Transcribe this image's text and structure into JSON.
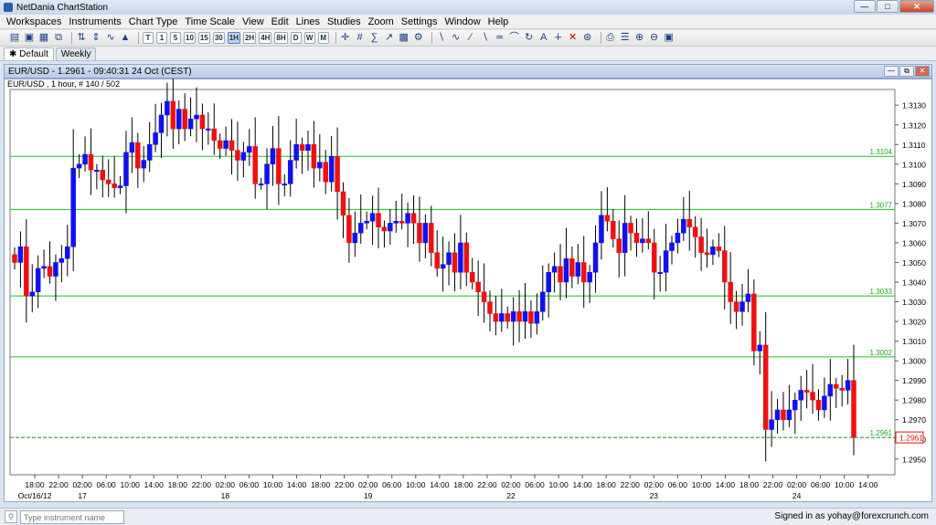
{
  "window": {
    "title": "NetDania ChartStation"
  },
  "menu": [
    "Workspaces",
    "Instruments",
    "Chart Type",
    "Time Scale",
    "View",
    "Edit",
    "Lines",
    "Studies",
    "Zoom",
    "Settings",
    "Window",
    "Help"
  ],
  "toolbar": {
    "timeframes": [
      "T",
      "1",
      "5",
      "10",
      "15",
      "30",
      "1H",
      "2H",
      "4H",
      "8H",
      "D",
      "W",
      "M"
    ],
    "selected_timeframe": "1H"
  },
  "tabs": [
    {
      "label": "Default",
      "active": true
    },
    {
      "label": "Weekly",
      "active": false
    }
  ],
  "chart_window": {
    "title": "EUR/USD - 1.2961 - 09:40:31  24 Oct (CEST)"
  },
  "chart_info": "EUR/USD , 1 hour, # 140 / 502",
  "colors": {
    "up": "#1010f0",
    "down": "#f01010",
    "hline": "#1fc01f",
    "current": "#1a8a1a",
    "price_tag": "#e01010"
  },
  "chart_data": {
    "type": "candlestick",
    "symbol": "EUR/USD",
    "ylim": [
      1.2942,
      1.3138
    ],
    "y_ticks": [
      "1.3130",
      "1.3120",
      "1.3110",
      "1.3100",
      "1.3090",
      "1.3080",
      "1.3070",
      "1.3060",
      "1.3050",
      "1.3040",
      "1.3030",
      "1.3020",
      "1.3010",
      "1.3000",
      "1.2990",
      "1.2980",
      "1.2970",
      "1.2960",
      "1.2950"
    ],
    "x_ticks": [
      "18:00",
      "22:00",
      "02:00",
      "06:00",
      "10:00",
      "14:00",
      "18:00",
      "22:00",
      "02:00",
      "06:00",
      "10:00",
      "14:00",
      "18:00",
      "22:00",
      "02:00",
      "06:00",
      "10:00",
      "14:00",
      "18:00",
      "22:00",
      "02:00",
      "06:00",
      "10:00",
      "14:00",
      "18:00",
      "22:00",
      "02:00",
      "06:00",
      "10:00",
      "14:00",
      "18:00",
      "22:00",
      "02:00",
      "06:00",
      "10:00",
      "14:00"
    ],
    "date_labels": [
      {
        "label": "Oct/16/12",
        "tick_index": 0
      },
      {
        "label": "17",
        "tick_index": 2
      },
      {
        "label": "18",
        "tick_index": 8
      },
      {
        "label": "19",
        "tick_index": 14
      },
      {
        "label": "22",
        "tick_index": 20
      },
      {
        "label": "23",
        "tick_index": 26
      },
      {
        "label": "24",
        "tick_index": 32
      }
    ],
    "horizontal_lines": [
      {
        "value": 1.3104,
        "label": "1.3104"
      },
      {
        "value": 1.3077,
        "label": "1.3077"
      },
      {
        "value": 1.3033,
        "label": "1.3033"
      },
      {
        "value": 1.3002,
        "label": "1.3002"
      },
      {
        "value": 1.2961,
        "label": "1.2961"
      }
    ],
    "current_price": "1.2961",
    "closes": [
      1.305,
      1.3058,
      1.3033,
      1.3035,
      1.3047,
      1.3048,
      1.3043,
      1.305,
      1.3052,
      1.3058,
      1.3098,
      1.31,
      1.3105,
      1.3097,
      1.3097,
      1.3092,
      1.309,
      1.3088,
      1.3089,
      1.3106,
      1.3111,
      1.3098,
      1.3102,
      1.311,
      1.3116,
      1.3125,
      1.3132,
      1.3118,
      1.3128,
      1.3118,
      1.3123,
      1.3125,
      1.3118,
      1.3118,
      1.3112,
      1.3108,
      1.3112,
      1.3107,
      1.3102,
      1.3106,
      1.3109,
      1.309,
      1.309,
      1.31,
      1.3108,
      1.309,
      1.309,
      1.3102,
      1.311,
      1.3107,
      1.311,
      1.3098,
      1.3101,
      1.3091,
      1.3104,
      1.3086,
      1.3074,
      1.306,
      1.3065,
      1.307,
      1.3071,
      1.3075,
      1.3068,
      1.3066,
      1.307,
      1.3071,
      1.307,
      1.3075,
      1.307,
      1.306,
      1.307,
      1.3055,
      1.3047,
      1.3049,
      1.3055,
      1.3045,
      1.306,
      1.3045,
      1.304,
      1.3035,
      1.303,
      1.3024,
      1.302,
      1.3024,
      1.302,
      1.3025,
      1.302,
      1.3025,
      1.3019,
      1.3025,
      1.3035,
      1.3045,
      1.3048,
      1.304,
      1.3052,
      1.3043,
      1.305,
      1.304,
      1.3045,
      1.306,
      1.3074,
      1.3071,
      1.3062,
      1.3055,
      1.307,
      1.3065,
      1.306,
      1.3062,
      1.306,
      1.3045,
      1.3045,
      1.3056,
      1.306,
      1.3065,
      1.3072,
      1.3068,
      1.3063,
      1.3055,
      1.3054,
      1.3058,
      1.3056,
      1.304,
      1.303,
      1.3025,
      1.303,
      1.3034,
      1.3005,
      1.3008,
      1.2965,
      1.297,
      1.2975,
      1.297,
      1.2975,
      1.298,
      1.2985,
      1.2984,
      1.298,
      1.2975,
      1.2982,
      1.2988,
      1.2986,
      1.2985,
      1.299,
      1.2961
    ]
  },
  "statusbar": {
    "instrument_placeholder": "Type instrument name",
    "signed_in": "Signed in as yohay@forexcrunch.com"
  }
}
